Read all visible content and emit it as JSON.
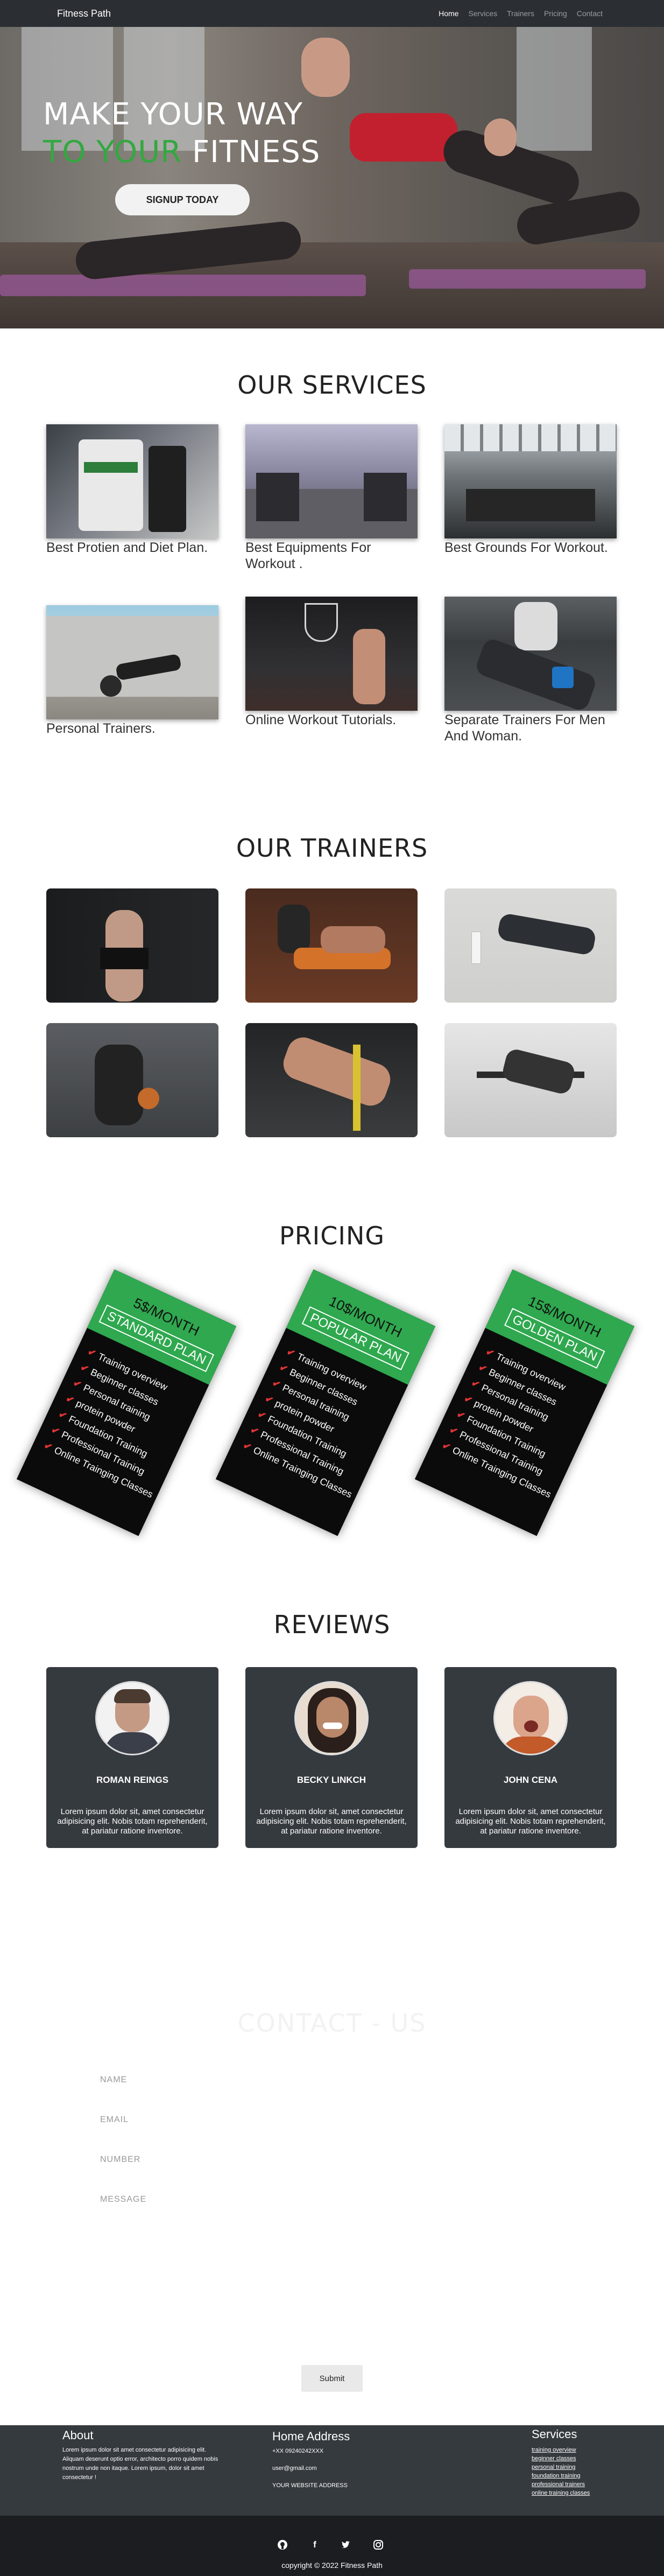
{
  "nav": {
    "brand": "Fitness Path",
    "links": [
      {
        "label": "Home",
        "active": true
      },
      {
        "label": "Services",
        "active": false
      },
      {
        "label": "Trainers",
        "active": false
      },
      {
        "label": "Pricing",
        "active": false
      },
      {
        "label": "Contact",
        "active": false
      }
    ]
  },
  "hero": {
    "line1": "MAKE YOUR WAY",
    "line2_green": "TO YOUR",
    "line2_white": " FITNESS",
    "cta": "SIGNUP TODAY"
  },
  "services": {
    "title": "OUR SERVICES",
    "items": [
      {
        "caption": "Best Protien and Diet Plan."
      },
      {
        "caption": "Best Equipments For Workout ."
      },
      {
        "caption": "Best Grounds For Workout."
      },
      {
        "caption": "Personal Trainers."
      },
      {
        "caption": "Online Workout Tutorials."
      },
      {
        "caption": "Separate Trainers For Men And Woman."
      }
    ]
  },
  "trainers": {
    "title": "OUR TRAINERS"
  },
  "pricing": {
    "title": "PRICING",
    "plans": [
      {
        "price": "5$/MONTH",
        "name": "STANDARD PLAN",
        "features": [
          "Training overview",
          "Beginner classes",
          "Personal training",
          "protein powder",
          "Foundation Training",
          "Professional Training",
          "Online Trainging Classes"
        ]
      },
      {
        "price": "10$/MONTH",
        "name": "POPULAR PLAN",
        "features": [
          "Training overview",
          "Beginner classes",
          "Personal training",
          "protein powder",
          "Foundation Training",
          "Professional Training",
          "Online Trainging Classes"
        ]
      },
      {
        "price": "15$/MONTH",
        "name": "GOLDEN PLAN",
        "features": [
          "Training overview",
          "Beginner classes",
          "Personal training",
          "protein powder",
          "Foundation Training",
          "Professional Training",
          "Online Trainging Classes"
        ]
      }
    ]
  },
  "reviews": {
    "title": "REVIEWS",
    "items": [
      {
        "name": "ROMAN REINGS",
        "text": "Lorem ipsum dolor sit, amet consectetur adipisicing elit. Nobis totam reprehenderit, at pariatur ratione inventore."
      },
      {
        "name": "BECKY LINKCH",
        "text": "Lorem ipsum dolor sit, amet consectetur adipisicing elit. Nobis totam reprehenderit, at pariatur ratione inventore."
      },
      {
        "name": "JOHN CENA",
        "text": "Lorem ipsum dolor sit, amet consectetur adipisicing elit. Nobis totam reprehenderit, at pariatur ratione inventore."
      }
    ]
  },
  "contact": {
    "title": "CONTACT - US",
    "fields": [
      "NAME",
      "EMAIL",
      "NUMBER",
      "MESSAGE"
    ],
    "submit": "Submit"
  },
  "footer": {
    "about_title": "About",
    "about_text": "Lorem ipsum dolor sit amet consectetur adipisicing elit. Aliquam deserunt optio error, architecto porro quidem nobis nostrum unde non itaque. Lorem ipsum, dolor sit amet consectetur !",
    "address_title": "Home Address",
    "phone": "+XX 09240242XXX",
    "email": "user@gmail.com",
    "website": "YOUR WEBSITE ADDRESS",
    "services_title": "Services",
    "services_links": [
      "training overview",
      "beginner classes",
      "personal training",
      "foundation training",
      "professional trainers",
      "online training classes"
    ],
    "copyright": "copyright © 2022 Fitness Path",
    "social": [
      "github-icon",
      "facebook-icon",
      "twitter-icon",
      "instagram-icon"
    ]
  },
  "colors": {
    "accent_green": "#33a840",
    "nav_bg": "#2b2f33",
    "card_green": "#2fa84f",
    "check_red": "#e23434",
    "review_bg": "#353a3f",
    "footer_bottom": "#1b1d20"
  }
}
